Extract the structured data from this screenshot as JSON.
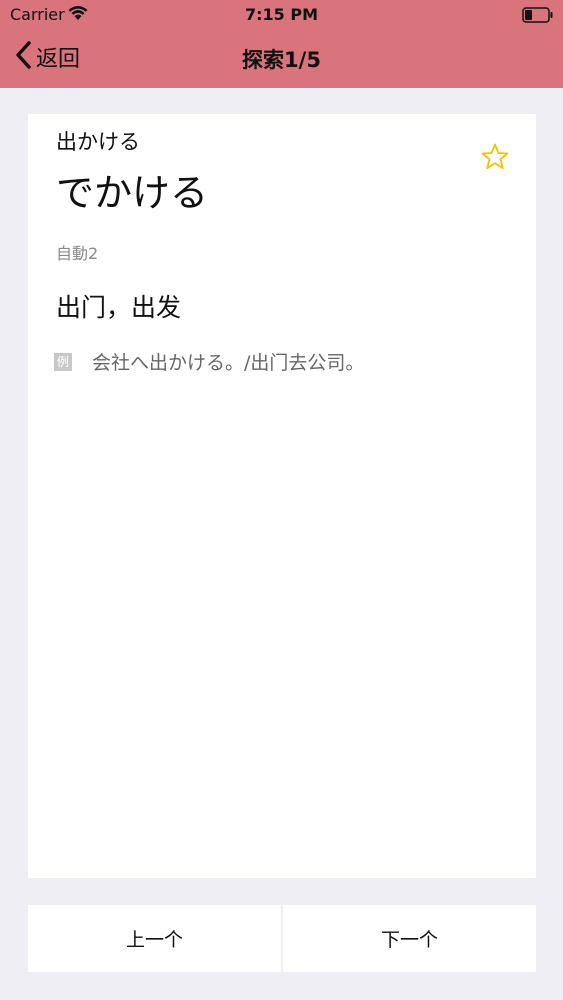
{
  "status_bar": {
    "carrier": "Carrier",
    "time": "7:15 PM"
  },
  "nav": {
    "back_label": "返回",
    "title": "探索1/5"
  },
  "word": {
    "kanji": "出かける",
    "kana": "でかける",
    "part_of_speech": "自動2",
    "meaning": "出门，出发",
    "example_badge": "例",
    "example": "会社へ出かける。/出门去公司。"
  },
  "buttons": {
    "prev": "上一个",
    "next": "下一个"
  },
  "colors": {
    "header": "#d9747c",
    "star": "#f2c300",
    "background": "#efeef4"
  }
}
